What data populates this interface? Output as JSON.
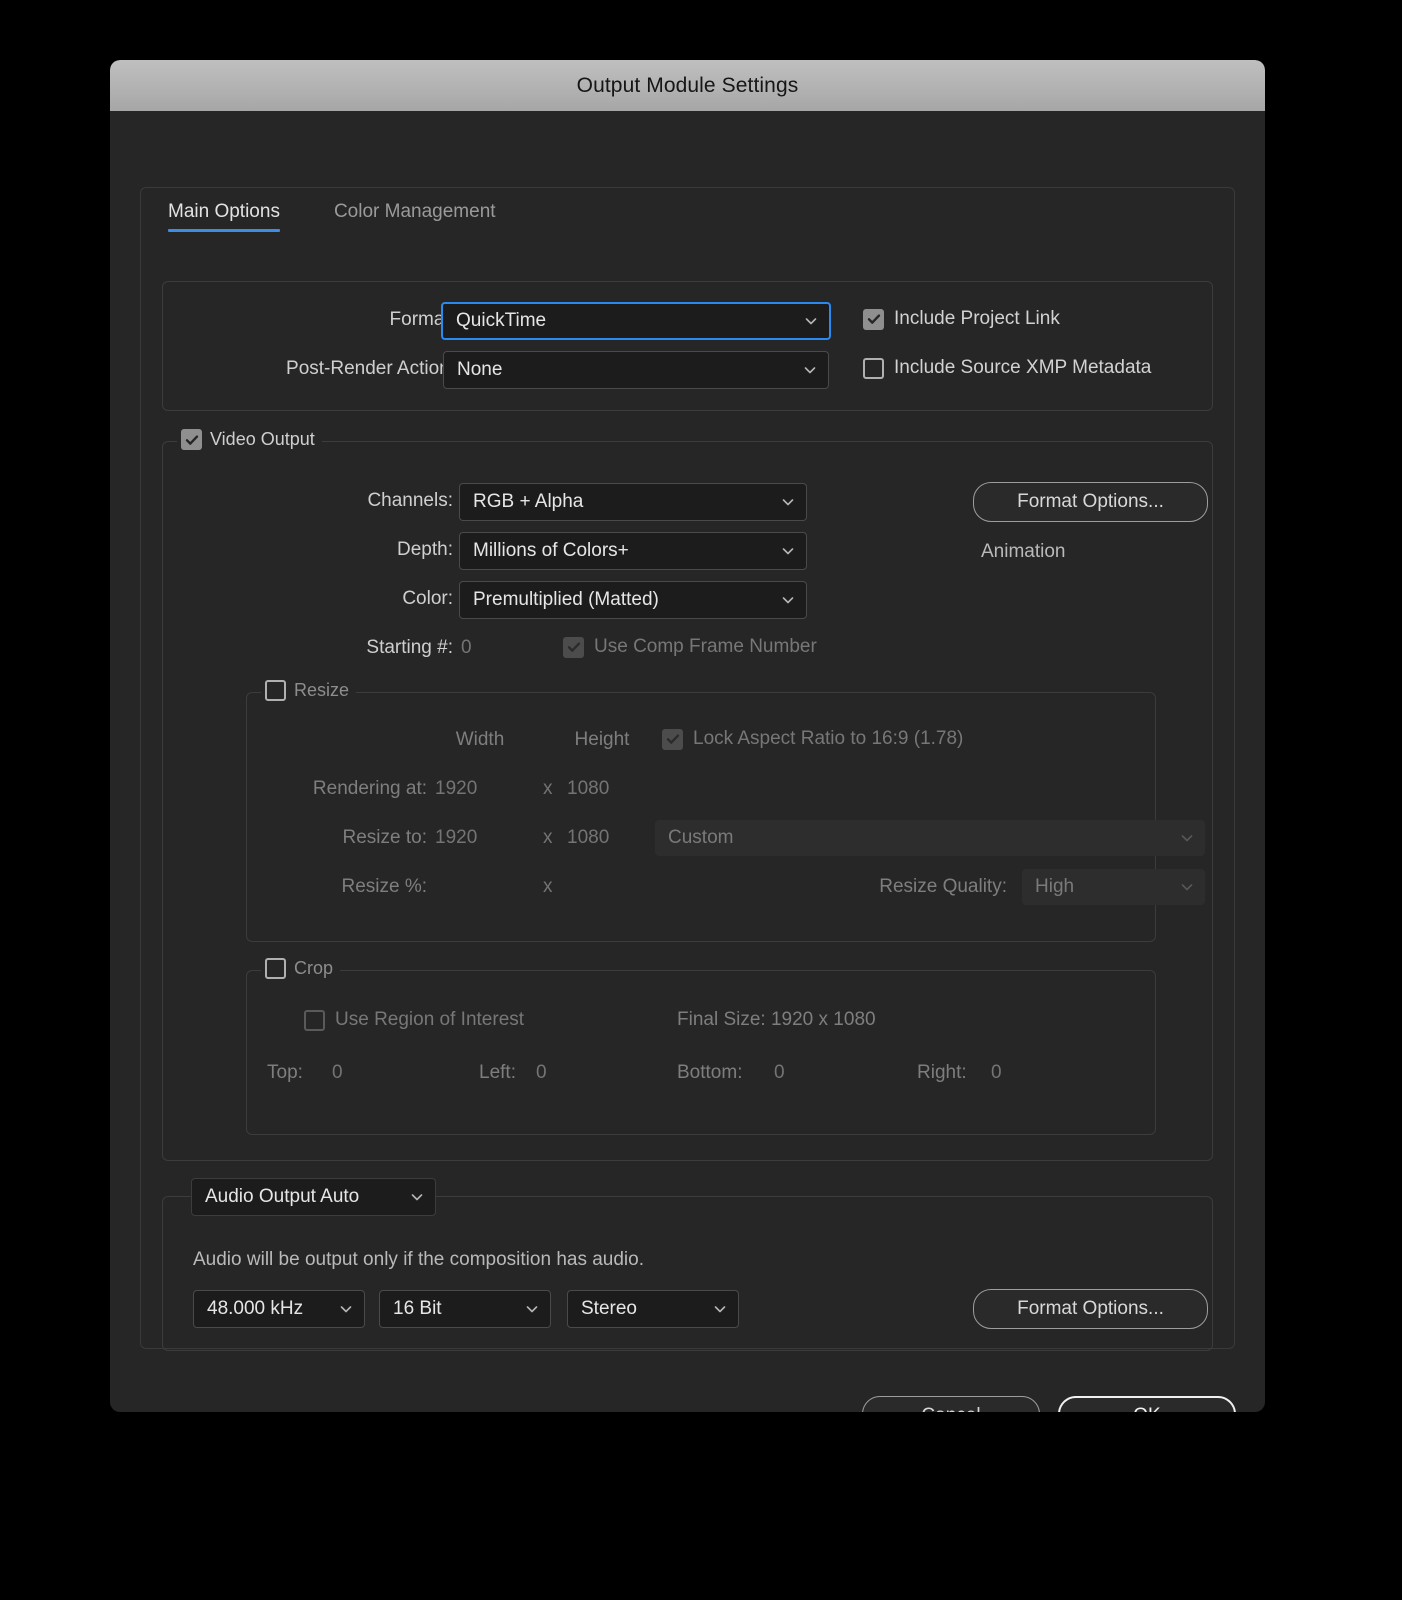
{
  "window": {
    "title": "Output Module Settings"
  },
  "tabs": [
    {
      "label": "Main Options",
      "active": true
    },
    {
      "label": "Color Management",
      "active": false
    }
  ],
  "format_section": {
    "format_label": "Format:",
    "format_value": "QuickTime",
    "post_render_label": "Post-Render Action:",
    "post_render_value": "None",
    "include_project_link_label": "Include Project Link",
    "include_project_link_checked": true,
    "include_xmp_label": "Include Source XMP Metadata",
    "include_xmp_checked": false
  },
  "video_output": {
    "legend": "Video Output",
    "checked": true,
    "channels_label": "Channels:",
    "channels_value": "RGB + Alpha",
    "depth_label": "Depth:",
    "depth_value": "Millions of Colors+",
    "color_label": "Color:",
    "color_value": "Premultiplied (Matted)",
    "starting_label": "Starting #:",
    "starting_value": "0",
    "use_comp_frame_label": "Use Comp Frame Number",
    "use_comp_frame_checked": true,
    "format_options_label": "Format Options...",
    "codec_name": "Animation"
  },
  "resize": {
    "legend": "Resize",
    "checked": false,
    "width_header": "Width",
    "height_header": "Height",
    "lock_aspect_label": "Lock Aspect Ratio to 16:9 (1.78)",
    "lock_aspect_checked": true,
    "rendering_at_label": "Rendering at:",
    "rendering_at_width": "1920",
    "rendering_at_x": "x",
    "rendering_at_height": "1080",
    "resize_to_label": "Resize to:",
    "resize_to_width": "1920",
    "resize_to_x": "x",
    "resize_to_height": "1080",
    "preset_value": "Custom",
    "resize_pct_label": "Resize %:",
    "resize_pct_x": "x",
    "resize_quality_label": "Resize Quality:",
    "resize_quality_value": "High"
  },
  "crop": {
    "legend": "Crop",
    "checked": false,
    "use_roi_label": "Use Region of Interest",
    "use_roi_checked": false,
    "final_size_label": "Final Size: 1920 x 1080",
    "top_label": "Top:",
    "top_value": "0",
    "left_label": "Left:",
    "left_value": "0",
    "bottom_label": "Bottom:",
    "bottom_value": "0",
    "right_label": "Right:",
    "right_value": "0"
  },
  "audio": {
    "legend_value": "Audio Output Auto",
    "note": "Audio will be output only if the composition has audio.",
    "sample_rate": "48.000 kHz",
    "bit_depth": "16 Bit",
    "channels": "Stereo",
    "format_options_label": "Format Options..."
  },
  "footer": {
    "cancel_label": "Cancel",
    "ok_label": "OK"
  },
  "colors": {
    "accent": "#3a8ee6",
    "focus_border": "#2a8af0",
    "dialog_bg": "#262626",
    "titlebar": "#b2b2b2"
  }
}
